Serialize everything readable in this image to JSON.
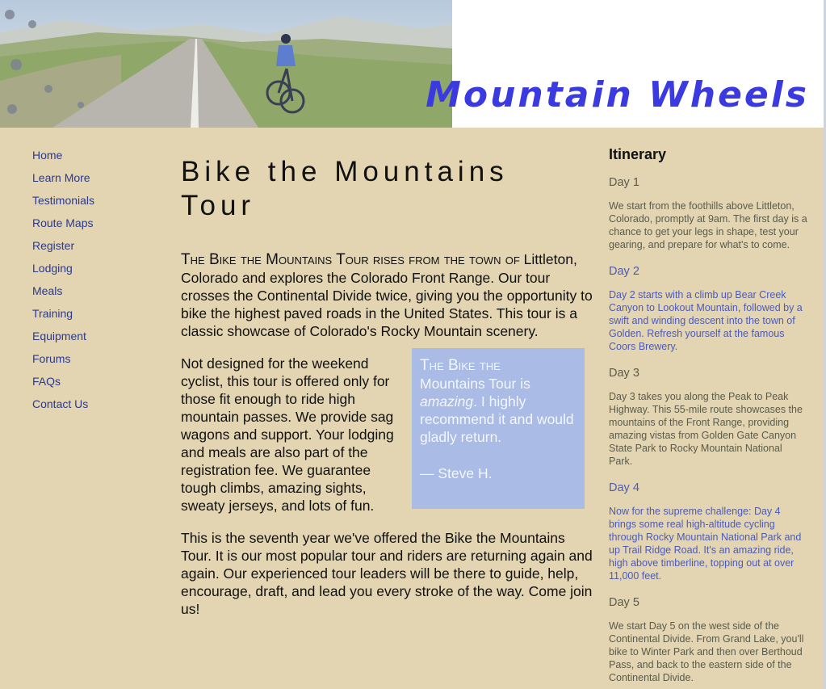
{
  "header": {
    "logo_text": "Mountain Wheels",
    "hero_image": "cyclist-on-mountain-road-photo"
  },
  "nav": {
    "items": [
      "Home",
      "Learn More",
      "Testimonials",
      "Route Maps",
      "Register",
      "Lodging",
      "Meals",
      "Training",
      "Equipment",
      "Forums",
      "FAQs",
      "Contact Us"
    ]
  },
  "main": {
    "title": "Bike the Mountains Tour",
    "intro_lead": "The Bike the Mountains Tour rises from the town of",
    "intro_rest": "Littleton, Colorado and explores the Colorado Front Range. Our tour crosses the Continental Divide twice, giving you the opportunity to bike the highest paved roads in the United States. This tour is a classic showcase of Colorado's Rocky Mountain scenery.",
    "quote": {
      "lead": "The Bike the",
      "line": "Mountains Tour is",
      "emphasis": "amazing",
      "rest": ". I highly recommend it and would gladly return.",
      "author": "— Steve H."
    },
    "para2": "Not designed for the weekend cyclist, this tour is offered only for those fit enough to ride high mountain passes. We provide sag wagons and support. Your lodging and meals are also part of the registration fee. We guarantee tough climbs, amazing sights, sweaty jerseys, and lots of fun.",
    "para3": "This is the seventh year we've offered the Bike the Mountains Tour. It is our most popular tour and riders are returning again and again. Our experienced tour leaders will be there to guide, help, encourage, draft, and lead you every stroke of the way. Come join us!"
  },
  "itinerary": {
    "title": "Itinerary",
    "days": [
      {
        "label": "Day 1",
        "text": "We start from the foothills above Littleton, Colorado, promptly at 9am. The first day is a chance to get your legs in shape, test your gearing, and prepare for what's to come."
      },
      {
        "label": "Day 2",
        "text": "Day 2 starts with a climb up Bear Creek Canyon to Lookout Mountain, followed by a swift and winding descent into the town of Golden. Refresh yourself at the famous Coors Brewery."
      },
      {
        "label": "Day 3",
        "text": "Day 3 takes you along the Peak to Peak Highway. This 55-mile route showcases the mountains of the Front Range, providing amazing vistas from Golden Gate Canyon State Park to Rocky Mountain National Park."
      },
      {
        "label": "Day 4",
        "text": "Now for the supreme challenge: Day 4 brings some real high-altitude cycling through Rocky Mountain National Park and up Trail Ridge Road. It's an amazing ride, high above timberline, topping out at over 11,000 feet."
      },
      {
        "label": "Day 5",
        "text": "We start Day 5 on the west side of the Continental Divide. From Grand Lake, you'll bike to Winter Park and then over Berthoud Pass, and back to the eastern side of the Continental Divide."
      }
    ]
  },
  "colors": {
    "page_bg": "#e3d4b2",
    "logo": "#3a3ae0",
    "nav_link": "#2b3a8a",
    "quote_bg": "#aabbe6",
    "itinerary_even": "#4c5bb6",
    "itinerary_odd": "#5a5b4a"
  }
}
